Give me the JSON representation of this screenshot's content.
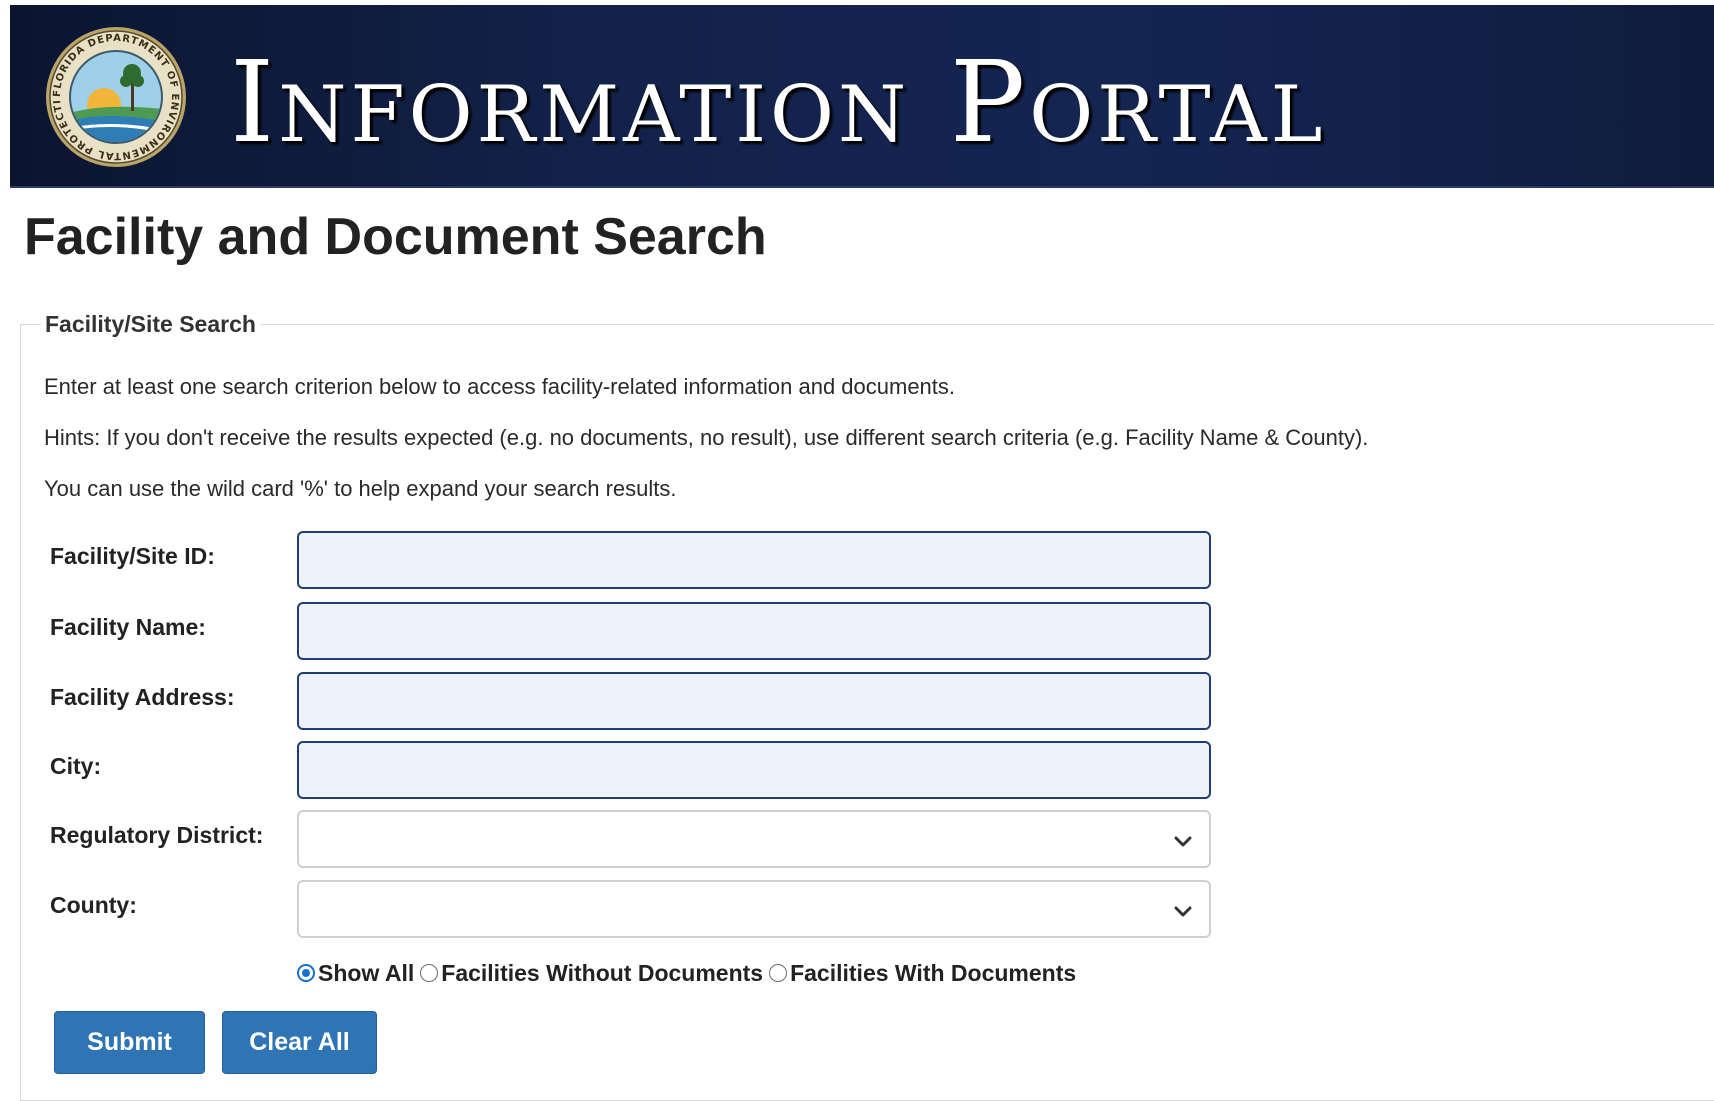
{
  "header": {
    "portal_title": "Information Portal",
    "seal_ring_text": "FLORIDA DEPARTMENT OF ENVIRONMENTAL PROTECTION"
  },
  "page": {
    "title": "Facility and Document Search"
  },
  "search": {
    "legend": "Facility/Site Search",
    "instructions": "Enter at least one search criterion below to access facility-related information and documents.",
    "hint": "Hints: If you don't receive the results expected (e.g. no documents, no result), use different search criteria (e.g. Facility Name & County).",
    "wildcard_note": "You can use the wild card '%' to help expand your search results.",
    "fields": {
      "facility_id": {
        "label": "Facility/Site ID:",
        "value": ""
      },
      "facility_name": {
        "label": "Facility Name:",
        "value": ""
      },
      "facility_address": {
        "label": "Facility Address:",
        "value": ""
      },
      "city": {
        "label": "City:",
        "value": ""
      },
      "regulatory_district": {
        "label": "Regulatory District:",
        "selected": ""
      },
      "county": {
        "label": "County:",
        "selected": ""
      }
    },
    "document_filter": {
      "selected": "Show All",
      "options": [
        "Show All",
        "Facilities Without Documents",
        "Facilities With Documents"
      ]
    },
    "buttons": {
      "submit": "Submit",
      "clear": "Clear All"
    }
  },
  "colors": {
    "banner": "#13224a",
    "button": "#2f74b5",
    "input_bg": "#eef2fb",
    "input_border": "#1f3f74"
  }
}
